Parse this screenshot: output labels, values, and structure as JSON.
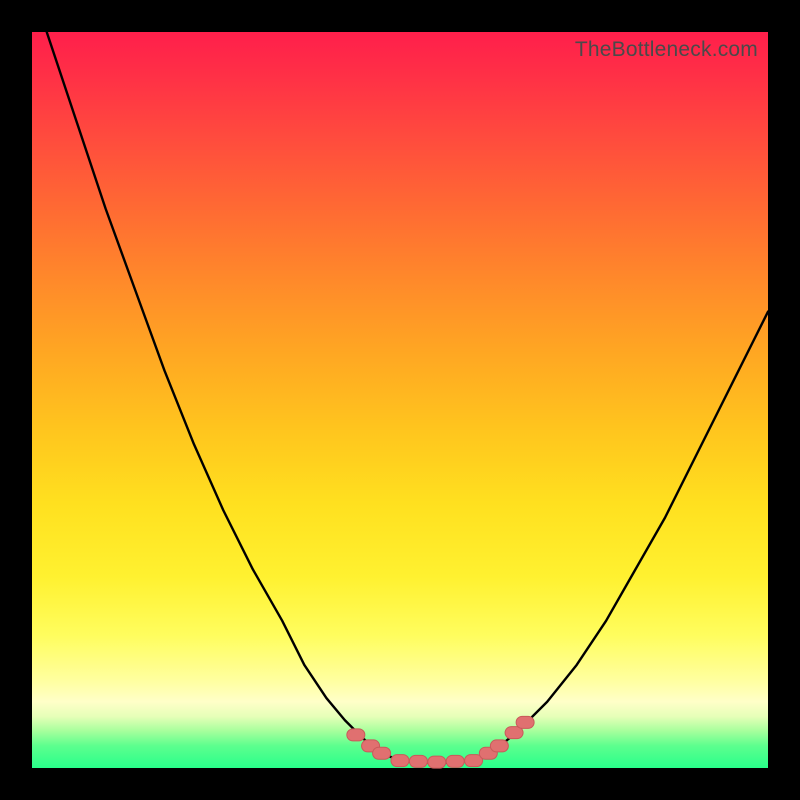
{
  "watermark": "TheBottleneck.com",
  "colors": {
    "frame": "#000000",
    "curve_stroke": "#000000",
    "marker_fill": "#e07070",
    "marker_stroke": "#c85a5a",
    "gradient_top": "#ff1f4b",
    "gradient_bottom": "#29ff8a"
  },
  "chart_data": {
    "type": "line",
    "title": "",
    "xlabel": "",
    "ylabel": "",
    "xlim": [
      0,
      100
    ],
    "ylim": [
      0,
      100
    ],
    "grid": false,
    "legend": false,
    "annotations": [],
    "series": [
      {
        "name": "left-curve",
        "x": [
          2,
          6,
          10,
          14,
          18,
          22,
          26,
          30,
          34,
          37,
          40,
          42.5,
          45,
          47.5,
          50
        ],
        "values": [
          100,
          88,
          76,
          65,
          54,
          44,
          35,
          27,
          20,
          14,
          9.5,
          6.5,
          4,
          2,
          1
        ]
      },
      {
        "name": "trough",
        "x": [
          50,
          52,
          54,
          56,
          58,
          60
        ],
        "values": [
          1,
          0.8,
          0.7,
          0.7,
          0.8,
          1
        ]
      },
      {
        "name": "right-curve",
        "x": [
          60,
          63,
          66,
          70,
          74,
          78,
          82,
          86,
          90,
          94,
          98,
          100
        ],
        "values": [
          1,
          2.5,
          5,
          9,
          14,
          20,
          27,
          34,
          42,
          50,
          58,
          62
        ]
      }
    ],
    "markers": [
      {
        "group": "left-cluster",
        "x": 44,
        "y": 4.5
      },
      {
        "group": "left-cluster",
        "x": 46,
        "y": 3
      },
      {
        "group": "left-cluster",
        "x": 47.5,
        "y": 2
      },
      {
        "group": "trough-cluster",
        "x": 50,
        "y": 1
      },
      {
        "group": "trough-cluster",
        "x": 52.5,
        "y": 0.9
      },
      {
        "group": "trough-cluster",
        "x": 55,
        "y": 0.8
      },
      {
        "group": "trough-cluster",
        "x": 57.5,
        "y": 0.9
      },
      {
        "group": "trough-cluster",
        "x": 60,
        "y": 1
      },
      {
        "group": "right-cluster",
        "x": 62,
        "y": 2
      },
      {
        "group": "right-cluster",
        "x": 63.5,
        "y": 3
      },
      {
        "group": "right-cluster",
        "x": 65.5,
        "y": 4.8
      },
      {
        "group": "right-cluster",
        "x": 67,
        "y": 6.2
      }
    ]
  }
}
